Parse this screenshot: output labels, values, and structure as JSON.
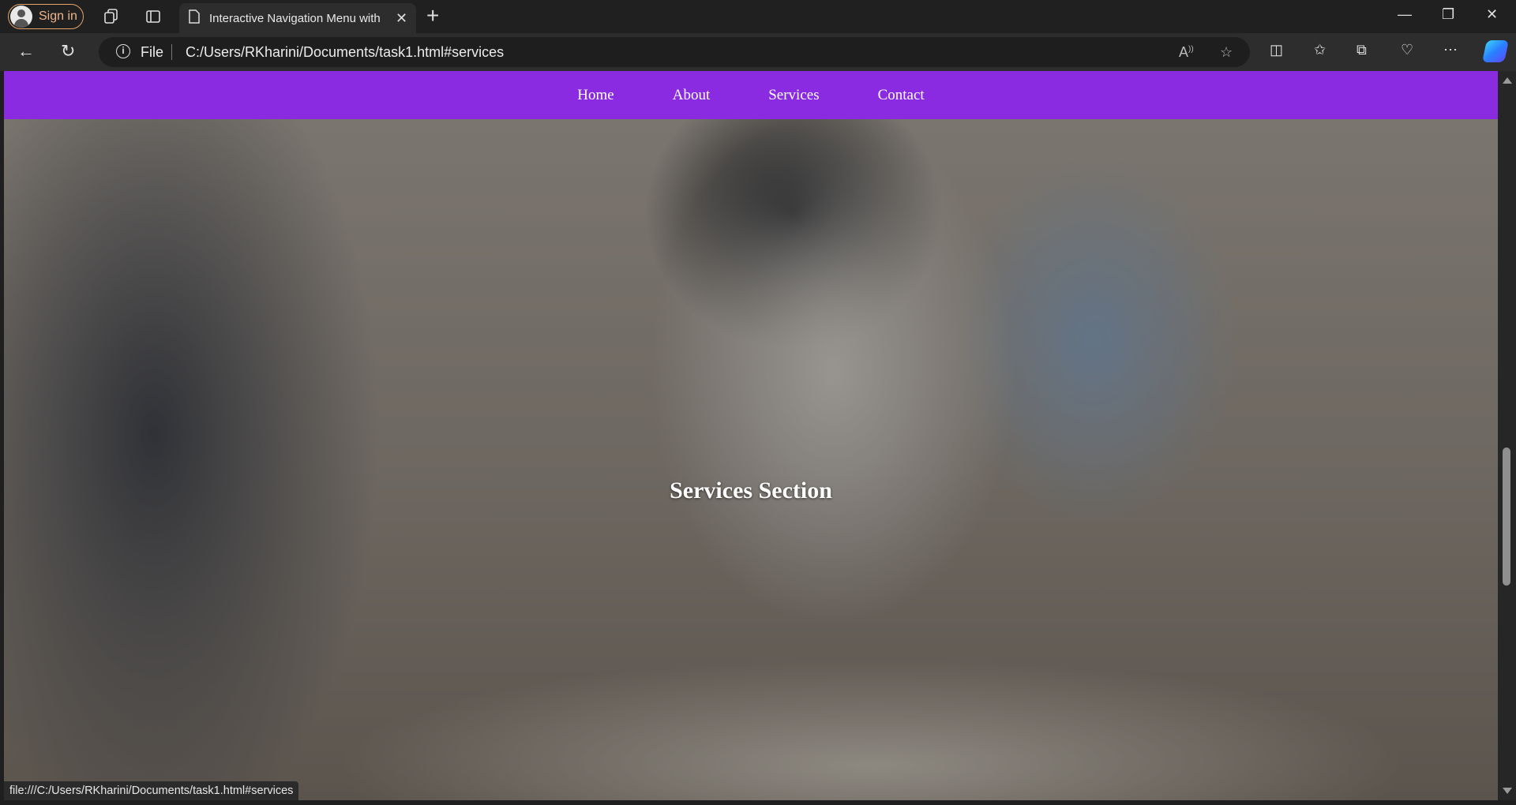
{
  "browser": {
    "signin_label": "Sign in",
    "tab_title": "Interactive Navigation Menu with",
    "address_scheme_label": "File",
    "address_url": "C:/Users/RKharini/Documents/task1.html#services",
    "status_url": "file:///C:/Users/RKharini/Documents/task1.html#services",
    "icons": {
      "workspaces": "workspaces-icon",
      "tab_actions": "tab-actions-icon",
      "page": "page-icon",
      "close_tab": "close-icon",
      "new_tab": "plus-icon",
      "minimize": "minimize-icon",
      "restore": "restore-icon",
      "close_window": "close-window-icon",
      "back": "back-arrow-icon",
      "refresh": "refresh-icon",
      "info": "info-icon",
      "read_aloud": "read-aloud-icon",
      "favorite": "star-icon",
      "split_screen": "split-screen-icon",
      "favorites": "favorites-icon",
      "collections": "collections-icon",
      "browser_essentials": "heart-pulse-icon",
      "more": "more-icon",
      "copilot": "copilot-icon"
    }
  },
  "page": {
    "nav": [
      "Home",
      "About",
      "Services",
      "Contact"
    ],
    "section_title": "Services Section",
    "nav_color": "#8a2be2",
    "background_image": "restaurant scene with waiter pouring red wine"
  }
}
